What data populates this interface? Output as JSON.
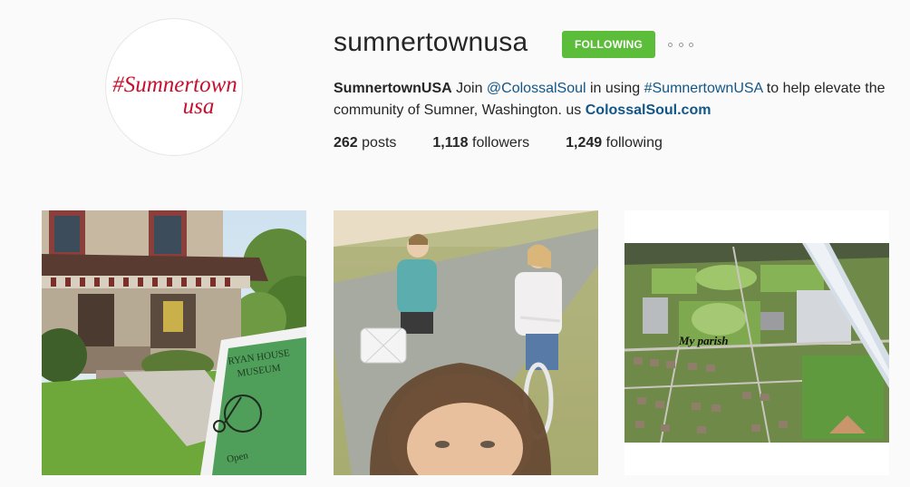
{
  "profile": {
    "username": "sumnertownusa",
    "avatar_text_line1": "#Sumnertown",
    "avatar_text_line2": "usa",
    "follow_label": "FOLLOWING",
    "bio_name": "SumnertownUSA",
    "bio_t1": " Join ",
    "bio_mention": "@ColossalSoul",
    "bio_t2": " in using ",
    "bio_hashtag": "#SumnertownUSA",
    "bio_t3": " to help elevate the community of Sumner, Washington. us ",
    "bio_url": "ColossalSoul.com"
  },
  "stats": {
    "posts_count": "262",
    "posts_label": " posts",
    "followers_count": "1,118",
    "followers_label": " followers",
    "following_count": "1,249",
    "following_label": " following"
  },
  "posts": [
    {
      "sign_line1": "RYAN HOUSE",
      "sign_line2": "MUSEUM",
      "sign_open": "Open"
    },
    {},
    {
      "caption": "My parish"
    }
  ],
  "colors": {
    "follow_green": "#5cbd3a",
    "link_blue": "#125688",
    "avatar_red": "#c8102e"
  }
}
